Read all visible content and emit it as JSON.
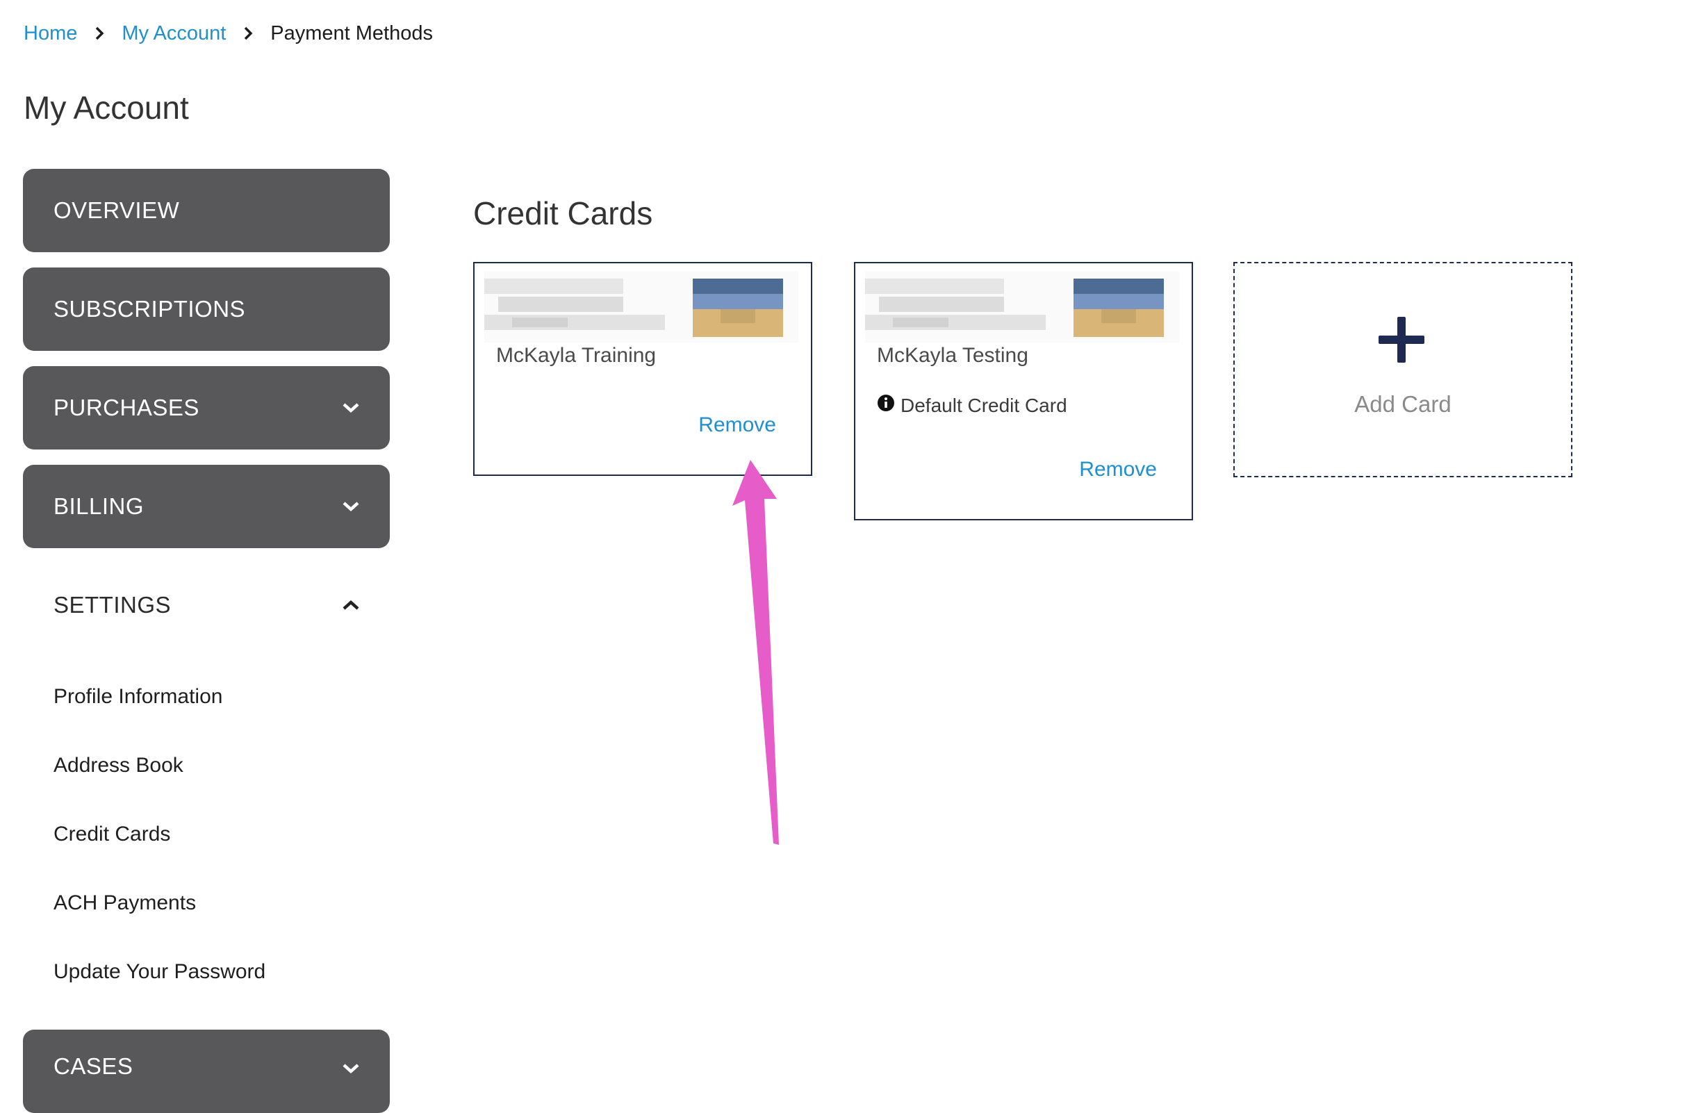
{
  "breadcrumb": {
    "home": "Home",
    "account": "My Account",
    "current": "Payment Methods"
  },
  "page_title": "My Account",
  "sidebar": {
    "overview": "OVERVIEW",
    "subscriptions": "SUBSCRIPTIONS",
    "purchases": "PURCHASES",
    "billing": "BILLING",
    "settings": "SETTINGS",
    "settings_items": [
      "Profile Information",
      "Address Book",
      "Credit Cards",
      "ACH Payments",
      "Update Your Password"
    ],
    "cases": "CASES"
  },
  "main": {
    "section_title": "Credit Cards",
    "cards": [
      {
        "name": "McKayla Training",
        "remove_label": "Remove"
      },
      {
        "name": "McKayla Testing",
        "default_label": "Default Credit Card",
        "remove_label": "Remove"
      }
    ],
    "add_card_label": "Add Card"
  },
  "colors": {
    "nav_bg": "#58585a",
    "link": "#1f8fd0",
    "card_border": "#1e2a52",
    "plus_icon": "#1e2a52",
    "annotation_arrow": "#e65cc8"
  },
  "icons": {
    "breadcrumb_separator": "chevron-right-icon",
    "expand": "chevron-down-icon",
    "collapse": "chevron-up-icon",
    "default_info": "info-icon",
    "add": "plus-icon"
  }
}
